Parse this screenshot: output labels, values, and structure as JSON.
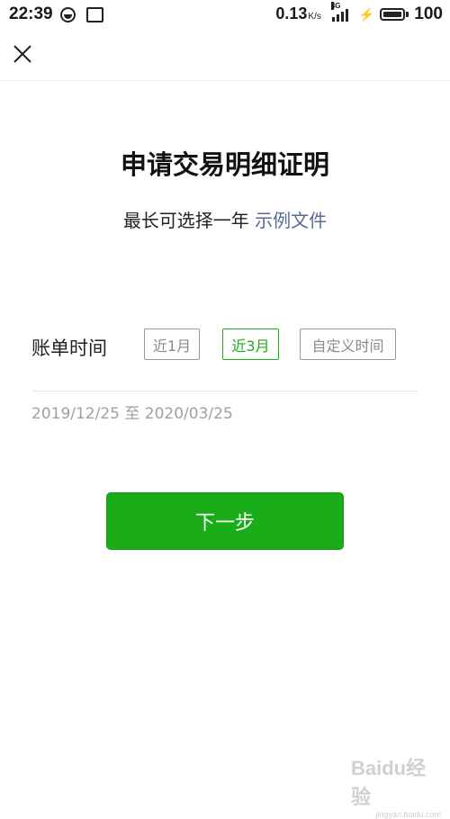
{
  "status_bar": {
    "time": "22:39",
    "net_speed": "0.13",
    "net_speed_unit": "K/s",
    "network_type": "4G",
    "battery": "100"
  },
  "header": {
    "close_icon": "close-icon"
  },
  "main": {
    "title": "申请交易明细证明",
    "subtitle": "最长可选择一年",
    "sample_link": "示例文件",
    "bill_time_label": "账单时间",
    "options": [
      {
        "label": "近1月",
        "selected": false
      },
      {
        "label": "近3月",
        "selected": true
      },
      {
        "label": "自定义时间",
        "selected": false
      }
    ],
    "date_range": "2019/12/25 至 2020/03/25",
    "next_button": "下一步"
  },
  "colors": {
    "accent_green": "#1aad19",
    "link_blue": "#576b95",
    "muted_text": "#a0a0a0"
  },
  "watermark": {
    "brand": "Baidu经验",
    "url": "jingyan.baidu.com"
  }
}
